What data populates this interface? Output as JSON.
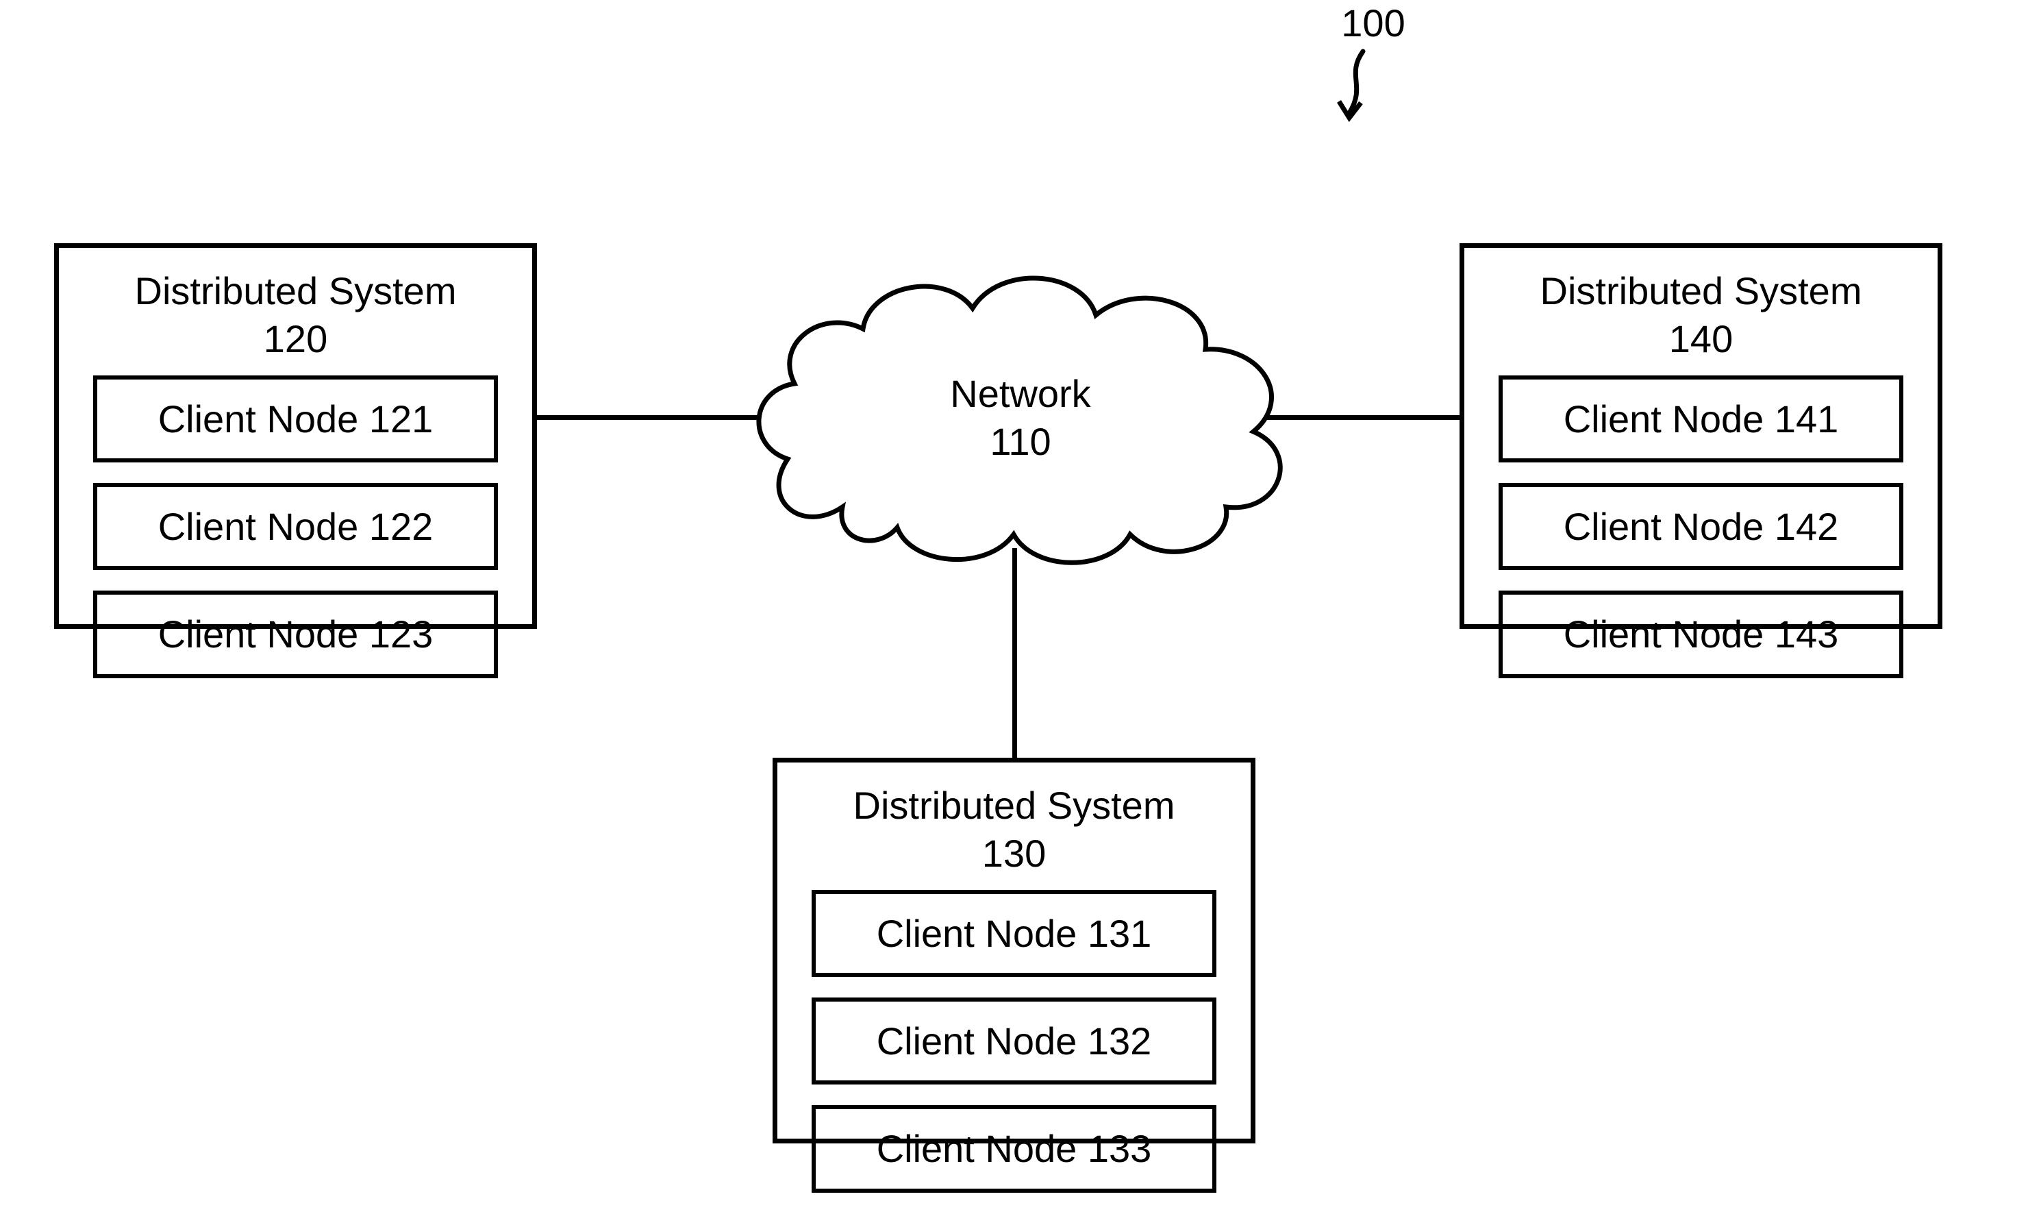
{
  "figure_ref_label": "100",
  "network": {
    "title": "Network",
    "ref": "110"
  },
  "systems": [
    {
      "title": "Distributed System",
      "ref": "120",
      "nodes": [
        {
          "label": "Client Node 121"
        },
        {
          "label": "Client Node 122"
        },
        {
          "label": "Client Node 123"
        }
      ]
    },
    {
      "title": "Distributed System",
      "ref": "130",
      "nodes": [
        {
          "label": "Client Node 131"
        },
        {
          "label": "Client Node 132"
        },
        {
          "label": "Client Node 133"
        }
      ]
    },
    {
      "title": "Distributed System",
      "ref": "140",
      "nodes": [
        {
          "label": "Client Node 141"
        },
        {
          "label": "Client Node 142"
        },
        {
          "label": "Client Node 143"
        }
      ]
    }
  ]
}
